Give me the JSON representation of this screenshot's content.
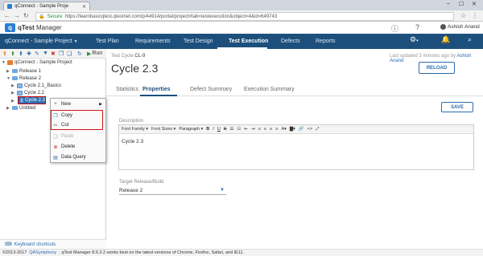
{
  "browser": {
    "tab_title": "qConnect - Sample Proje",
    "secure_label": "Secure",
    "url": "https://learnbasicqtest.qtestnet.com/p/44914/portal/project#tab=testexecution&object=4&id=649743"
  },
  "app": {
    "logo_letter": "q",
    "name_prefix": "qTest",
    "name_suffix": "Manager",
    "project": "qConnect - Sample Project",
    "user": "Ashish Anand",
    "accent": "#1d4f7c"
  },
  "nav": {
    "test_plan": "Test Plan",
    "requirements": "Requirements",
    "test_design": "Test Design",
    "test_execution": "Test Execution",
    "defects": "Defects",
    "reports": "Reports"
  },
  "tree": {
    "run_label": "Run",
    "root": "qConnect - Sample Project",
    "release1": "Release 1",
    "release2": "Release 2",
    "cycle21": "Cycle 2.1_Basics",
    "cycle22": "Cycle 2.2",
    "cycle23": "Cycle 2.3",
    "untitled": "Untitled"
  },
  "context_menu": {
    "new": "New",
    "copy": "Copy",
    "cut": "Cut",
    "paste": "Paste",
    "delete": "Delete",
    "data_query": "Data Query"
  },
  "main": {
    "crumb_prefix": "Test Cycle",
    "crumb_id": "CL-9",
    "updated_prefix": "Last updated 3 minutes ago by",
    "updated_user": "Ashish Anand",
    "title": "Cycle 2.3",
    "reload": "RELOAD",
    "tabs": {
      "statistics": "Statistics",
      "properties": "Properties",
      "defect_summary": "Defect Summary",
      "execution_summary": "Execution Summary"
    },
    "save": "SAVE",
    "description_label": "Description",
    "toolbar": {
      "font_family": "Font Family",
      "font_sizes": "Font Sizes",
      "paragraph": "Paragraph"
    },
    "description_text": "Cycle 2.3",
    "target_label": "Target Release/Build",
    "target_value": "Release 2"
  },
  "footer": {
    "keyboard_shortcuts": "Keyboard shortcuts",
    "copyright": "©2013-2017",
    "company": "QASymphony",
    "notice": ". qTest Manager 8.6.3.2 works best on the latest versions of Chrome, Firefox, Safari, and IE11."
  }
}
